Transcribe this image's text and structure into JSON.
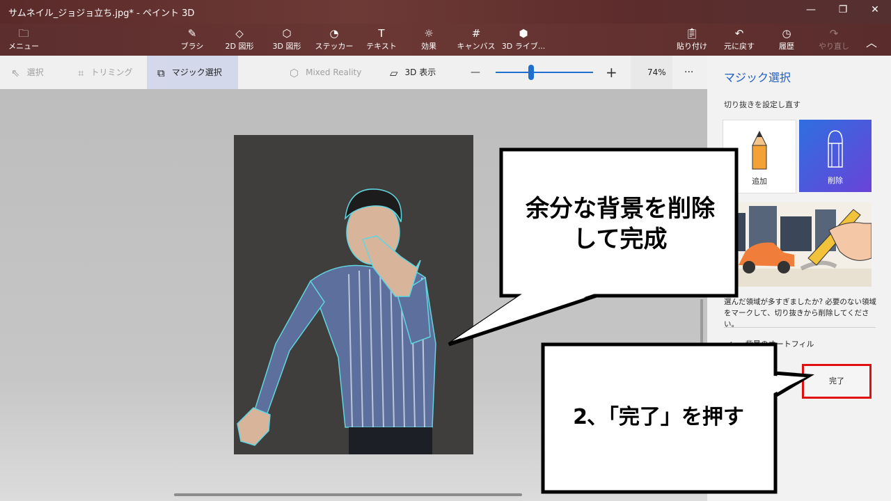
{
  "window": {
    "title": "サムネイル_ジョジョ立ち.jpg* - ペイント 3D",
    "minimize": "—",
    "restore": "❐",
    "close": "✕"
  },
  "toolbar": {
    "menu": "メニュー",
    "tools": [
      "ブラシ",
      "2D 図形",
      "3D 図形",
      "ステッカー",
      "テキスト",
      "効果",
      "キャンバス",
      "3D ライブ..."
    ],
    "paste": "貼り付け",
    "undo": "元に戻す",
    "history": "履歴",
    "redo": "やり直し"
  },
  "subbar": {
    "select": "選択",
    "crop": "トリミング",
    "magic_select": "マジック選択",
    "mixed_reality": "Mixed Reality",
    "view3d": "3D 表示",
    "zoom_minus": "—",
    "zoom_plus": "+",
    "zoom_value": "74%",
    "more": "···"
  },
  "panel": {
    "title": "マジック選択",
    "subtitle": "切り抜きを設定し直す",
    "add_label": "追加",
    "remove_label": "削除",
    "help_text": "選んだ領域が多すぎましたか? 必要のない領域をマークして、切り抜きから削除してください。",
    "autofill_label": "背景のオートフィル",
    "done_label": "完了"
  },
  "callouts": {
    "top_line1": "余分な背景を削除",
    "top_line2": "して完成",
    "bottom": "2､「完了」を押す"
  },
  "colors": {
    "accent": "#1f6fd0",
    "highlight_border": "#e01010"
  }
}
